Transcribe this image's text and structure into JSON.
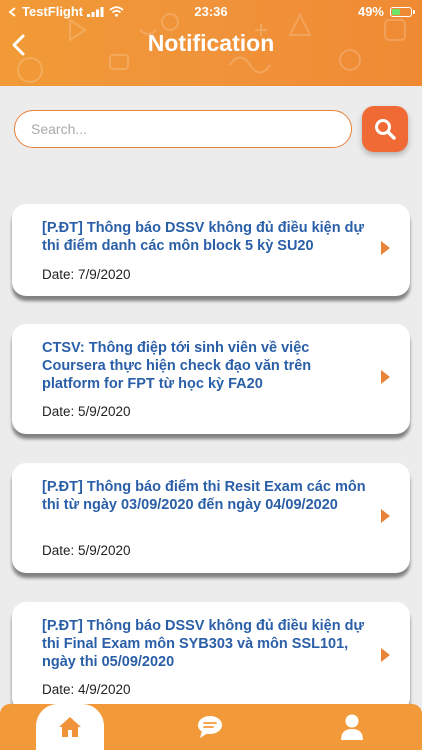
{
  "status_bar": {
    "carrier": "TestFlight",
    "time": "23:36",
    "battery_percent": "49%",
    "battery_level": 0.49
  },
  "header": {
    "title": "Notification",
    "back_icon": "chevron-left-icon"
  },
  "search": {
    "placeholder": "Search...",
    "value": "",
    "button_icon": "search-icon"
  },
  "notifications": [
    {
      "title": "[P.ĐT] Thông báo DSSV không đủ điều kiện dự thi điểm danh các môn block 5 kỳ SU20",
      "date": "Date: 7/9/2020"
    },
    {
      "title": "CTSV: Thông điệp tới sinh viên về việc Coursera thực hiện check đạo văn trên platform for FPT từ học kỳ FA20",
      "date": "Date: 5/9/2020"
    },
    {
      "title": "[P.ĐT] Thông báo điểm thi Resit Exam các môn thi từ ngày 03/09/2020 đến ngày 04/09/2020",
      "date": "Date: 5/9/2020"
    },
    {
      "title": "[P.ĐT] Thông báo DSSV không đủ điều kiện dự thi Final Exam môn SYB303 và môn SSL101, ngày thi 05/09/2020",
      "date": "Date: 4/9/2020"
    }
  ],
  "tabbar": {
    "tabs": [
      {
        "icon": "home-icon",
        "active": true
      },
      {
        "icon": "chat-bubble-icon",
        "active": false
      },
      {
        "icon": "user-icon",
        "active": false
      }
    ]
  },
  "colors": {
    "accent": "#f0933a",
    "search_button": "#f06a35",
    "title_blue": "#2a5fa8",
    "background": "#ececec"
  }
}
